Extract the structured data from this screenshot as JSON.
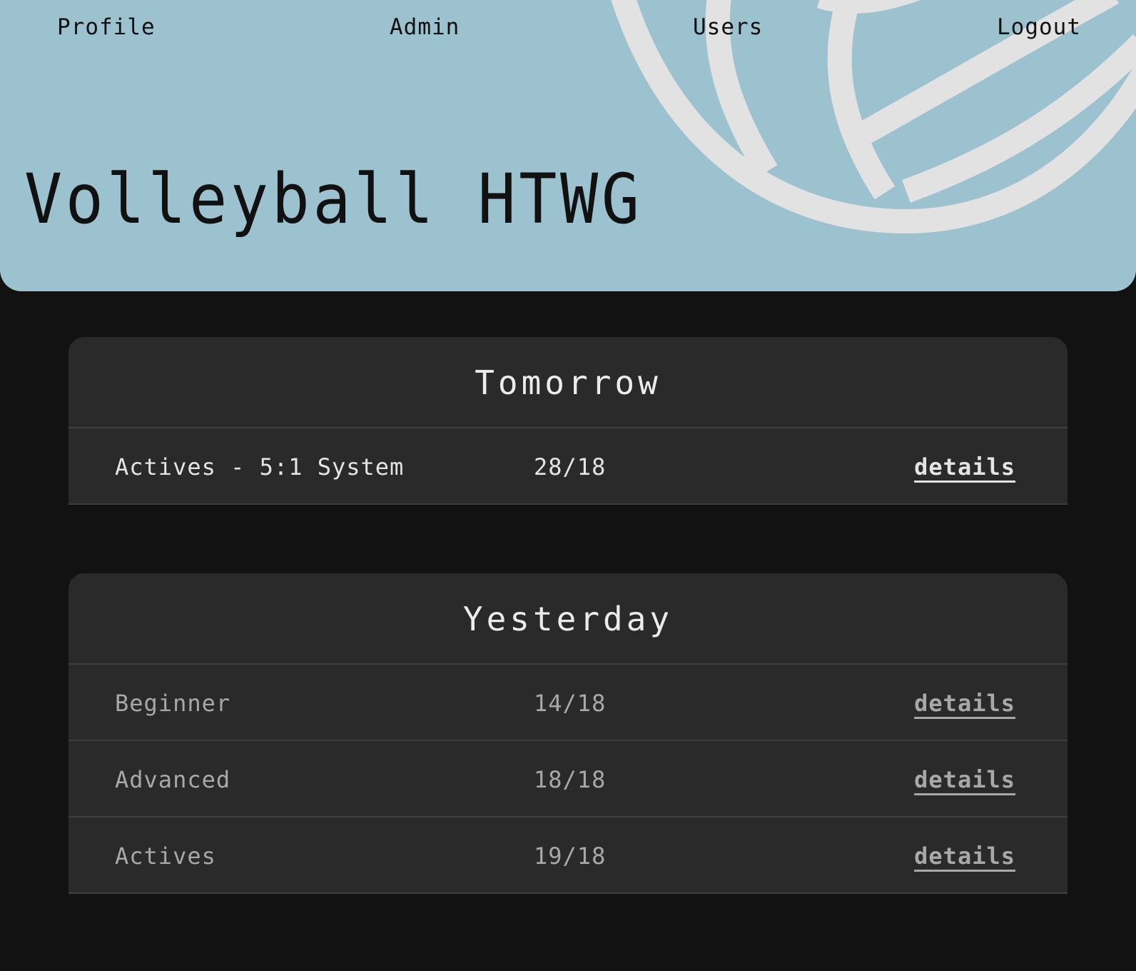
{
  "nav": {
    "profile": "Profile",
    "admin": "Admin",
    "users": "Users",
    "logout": "Logout"
  },
  "site_title": "Volleyball HTWG",
  "colors": {
    "header_bg": "#9dc2cf",
    "page_bg": "#121212",
    "card_bg": "#2a2a2a",
    "ball_lines": "#e2e2e2"
  },
  "sections": [
    {
      "title": "Tomorrow",
      "rows": [
        {
          "name": "Actives - 5:1 System",
          "count": "28/18",
          "link": "details"
        }
      ]
    },
    {
      "title": "Yesterday",
      "rows": [
        {
          "name": "Beginner",
          "count": "14/18",
          "link": "details"
        },
        {
          "name": "Advanced",
          "count": "18/18",
          "link": "details"
        },
        {
          "name": "Actives",
          "count": "19/18",
          "link": "details"
        }
      ]
    }
  ]
}
